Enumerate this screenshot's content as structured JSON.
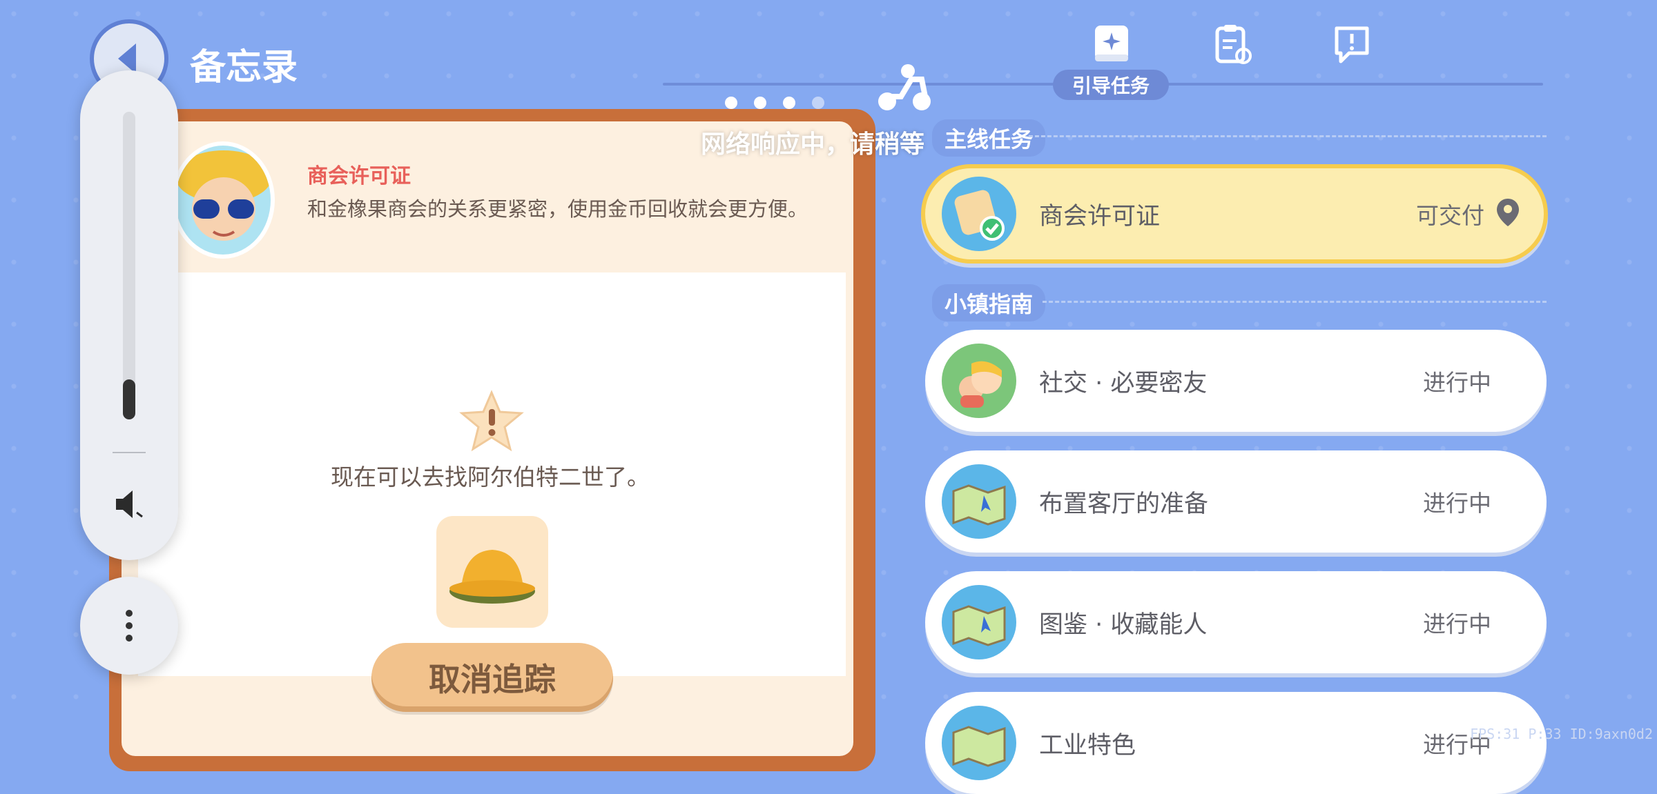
{
  "header": {
    "title": "备忘录"
  },
  "tabs": [
    {
      "label": "引导任务",
      "icon": "guide-book-icon",
      "active": true
    },
    {
      "label": "",
      "icon": "clipboard-refresh-icon",
      "active": false
    },
    {
      "label": "",
      "icon": "speech-exclaim-icon",
      "active": false
    }
  ],
  "loading": {
    "text": "网络响应中，请稍等"
  },
  "quest_detail": {
    "title": "商会许可证",
    "description": "和金橡果商会的关系更紧密，使用金币回收就会更方便。",
    "hint": "现在可以去找阿尔伯特二世了。",
    "cancel_label": "取消追踪"
  },
  "sections": {
    "main": "主线任务",
    "town": "小镇指南"
  },
  "quests": [
    {
      "name": "商会许可证",
      "status": "可交付",
      "icon": "merchant-license-icon",
      "active": true
    },
    {
      "name": "社交 · 必要密友",
      "status": "进行中",
      "icon": "friends-icon",
      "active": false
    },
    {
      "name": "布置客厅的准备",
      "status": "进行中",
      "icon": "map-icon",
      "active": false
    },
    {
      "name": "图鉴 · 收藏能人",
      "status": "进行中",
      "icon": "map-icon",
      "active": false
    },
    {
      "name": "工业特色",
      "status": "进行中",
      "icon": "map-icon",
      "active": false
    }
  ],
  "overlay": {
    "volume_level": 0.13
  },
  "debug_text": "FPS:31  P:33  ID:9axn0d2",
  "colors": {
    "background": "#85a9f1",
    "accent": "#f6cc4d",
    "frame": "#c86f3a",
    "quest_title": "#e8605a"
  }
}
